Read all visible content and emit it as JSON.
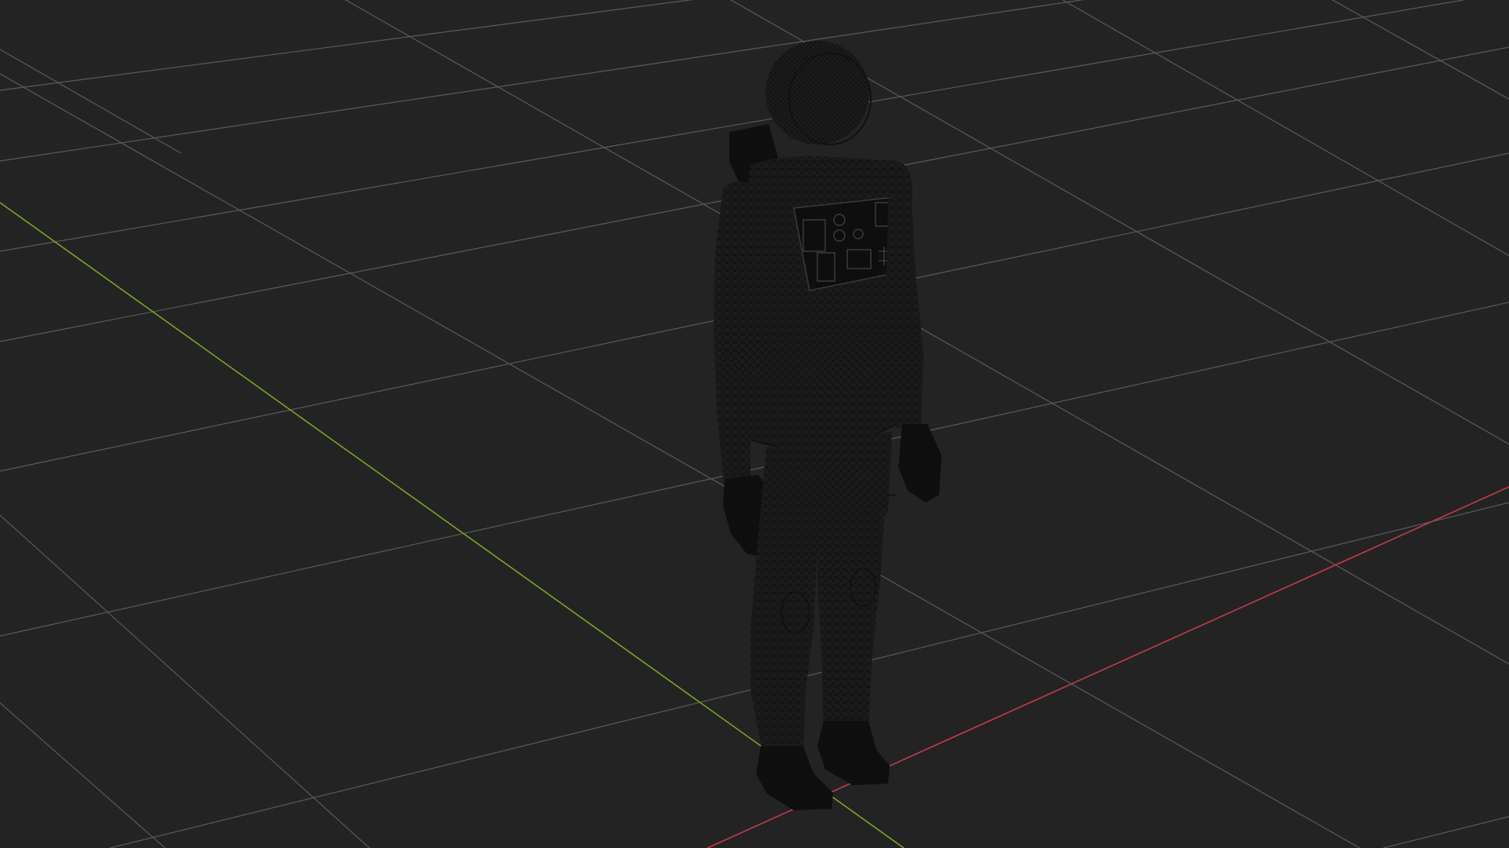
{
  "viewport": {
    "background": "#232323",
    "grid_color": "#5a5a5a",
    "render_mode": "wireframe",
    "axes": [
      {
        "name": "x",
        "color": "#c8384a"
      },
      {
        "name": "y",
        "color": "#7aa32a"
      }
    ],
    "model": {
      "name": "astronaut",
      "pose": "standing",
      "wire_color": "#111111"
    }
  }
}
